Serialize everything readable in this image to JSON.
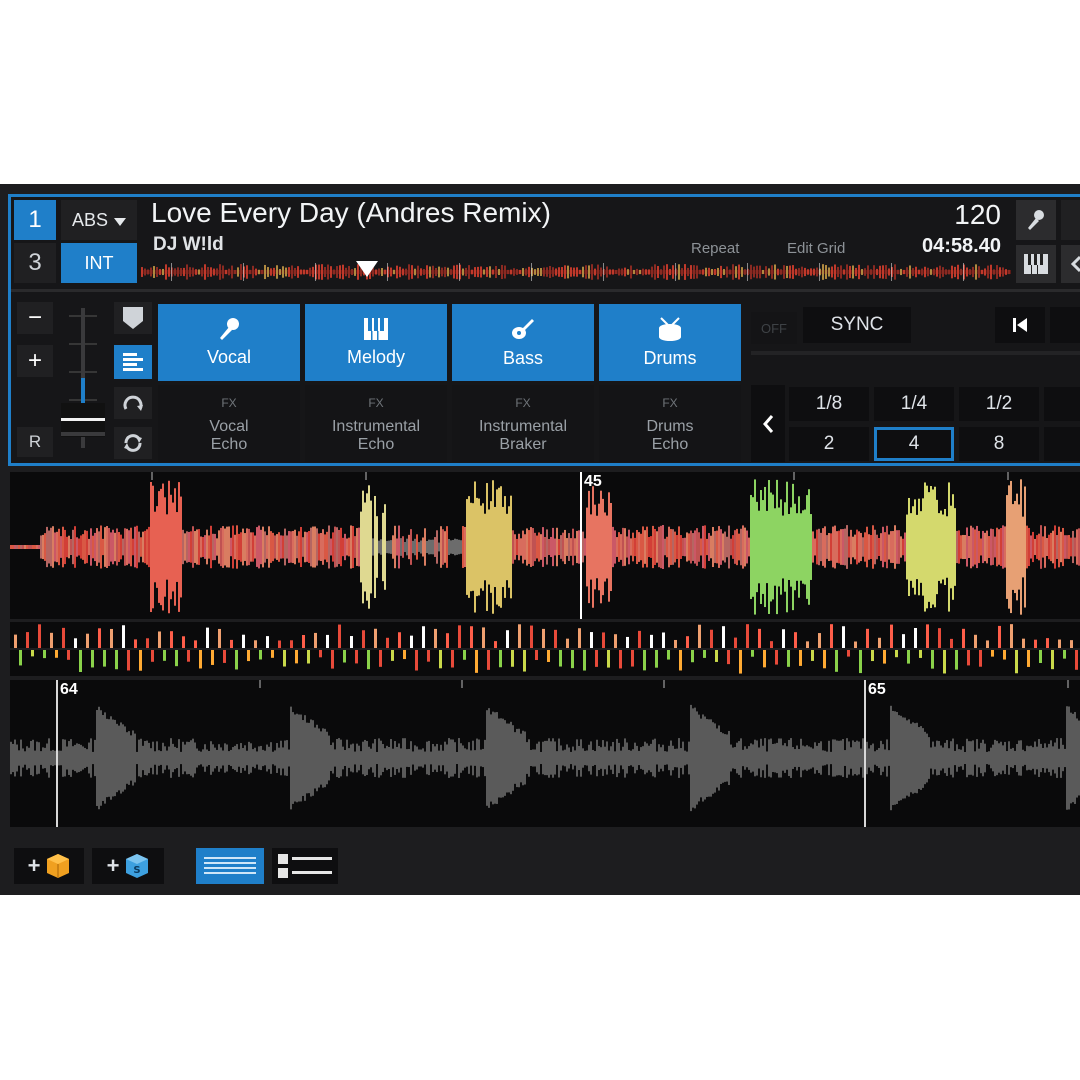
{
  "deck": {
    "number_top": "1",
    "number_bottom": "3",
    "abs_label": "ABS",
    "int_label": "INT",
    "track_title": "Love Every Day (Andres Remix)",
    "artist": "DJ W!ld",
    "bpm": "120",
    "time_remaining": "04:58.40",
    "repeat_label": "Repeat",
    "edit_grid_label": "Edit Grid",
    "play_position": 0.26
  },
  "pitch": {
    "minus_label": "−",
    "plus_label": "+",
    "reset_label": "R"
  },
  "stems": [
    {
      "label": "Vocal",
      "icon": "microphone-icon",
      "fx": "FX",
      "fx_name": "Vocal\nEcho"
    },
    {
      "label": "Melody",
      "icon": "piano-keys-icon",
      "fx": "FX",
      "fx_name": "Instrumental\nEcho"
    },
    {
      "label": "Bass",
      "icon": "guitar-icon",
      "fx": "FX",
      "fx_name": "Instrumental\nBraker"
    },
    {
      "label": "Drums",
      "icon": "drum-icon",
      "fx": "FX",
      "fx_name": "Drums\nEcho"
    }
  ],
  "sync": {
    "off_label": "OFF",
    "sync_label": "SYNC"
  },
  "loop": {
    "top": [
      "1/8",
      "1/4",
      "1/2"
    ],
    "bottom": [
      "2",
      "4",
      "8"
    ],
    "selected": "4"
  },
  "waveform_main": {
    "beat_label": "45"
  },
  "waveform_secondary": {
    "beat_label_left": "64",
    "beat_label_right": "65"
  },
  "bottom_bar": {
    "add_label_1": "+",
    "add_label_2": "+"
  },
  "colors": {
    "accent": "#1f7fc9",
    "background": "#1d1d1f"
  }
}
